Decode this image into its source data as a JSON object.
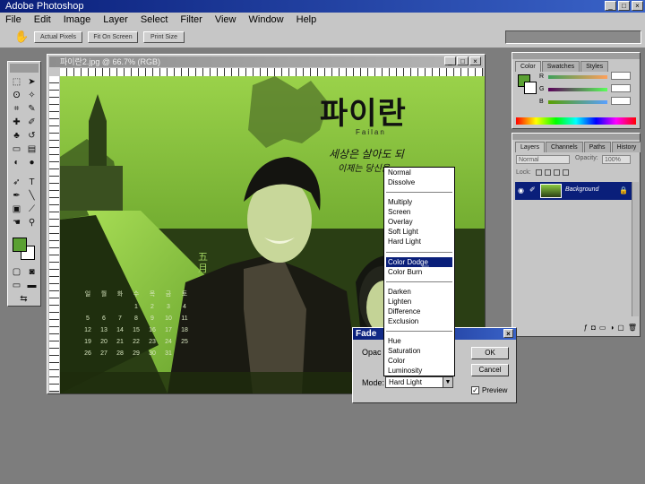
{
  "app": {
    "title": "Adobe Photoshop"
  },
  "menu": [
    "File",
    "Edit",
    "Image",
    "Layer",
    "Select",
    "Filter",
    "View",
    "Window",
    "Help"
  ],
  "options_bar": {
    "buttons": [
      "Actual Pixels",
      "Fit On Screen",
      "Print Size"
    ]
  },
  "document": {
    "title": "파이란2.jpg @ 66.7% (RGB)"
  },
  "artwork": {
    "title_calligraphy": "파이란",
    "subtitle": "Failan",
    "tagline_1": "세상은 살아도 되",
    "tagline_2": "이제는 당신을",
    "month": "五月",
    "calendar": [
      "일",
      "월",
      "화",
      "수",
      "목",
      "금",
      "토",
      "1",
      "2",
      "3",
      "4",
      "5",
      "6",
      "7",
      "8",
      "9",
      "10",
      "11",
      "12",
      "13",
      "14",
      "15",
      "16",
      "17",
      "18",
      "19",
      "20",
      "21",
      "22",
      "23",
      "24",
      "25",
      "26",
      "27",
      "28",
      "29",
      "30",
      "31"
    ]
  },
  "color_palette": {
    "tabs": [
      "Color",
      "Swatches",
      "Styles"
    ],
    "channels": [
      "R",
      "G",
      "B"
    ]
  },
  "layers_palette": {
    "tabs": [
      "Layers",
      "Channels",
      "Paths",
      "History"
    ],
    "blend_mode": "Normal",
    "opacity_label": "Opacity:",
    "opacity_value": "100%",
    "lock_label": "Lock:",
    "layer_name": "Background"
  },
  "fade_dialog": {
    "title": "Fade",
    "opacity_label": "Opac",
    "mode_label": "Mode:",
    "mode_value": "Hard Light",
    "ok": "OK",
    "cancel": "Cancel",
    "preview": "Preview"
  },
  "dropdown": {
    "items": [
      "Normal",
      "Dissolve",
      "Multiply",
      "Screen",
      "Overlay",
      "Soft Light",
      "Hard Light",
      "Color Dodge",
      "Color Burn",
      "Darken",
      "Lighten",
      "Difference",
      "Exclusion",
      "Hue",
      "Saturation",
      "Color",
      "Luminosity"
    ],
    "selected": "Color Dodge"
  },
  "colors": {
    "accent": "#0a1f7a",
    "foreground_swatch": "#5aa032",
    "image_green": "#7fc23a"
  }
}
